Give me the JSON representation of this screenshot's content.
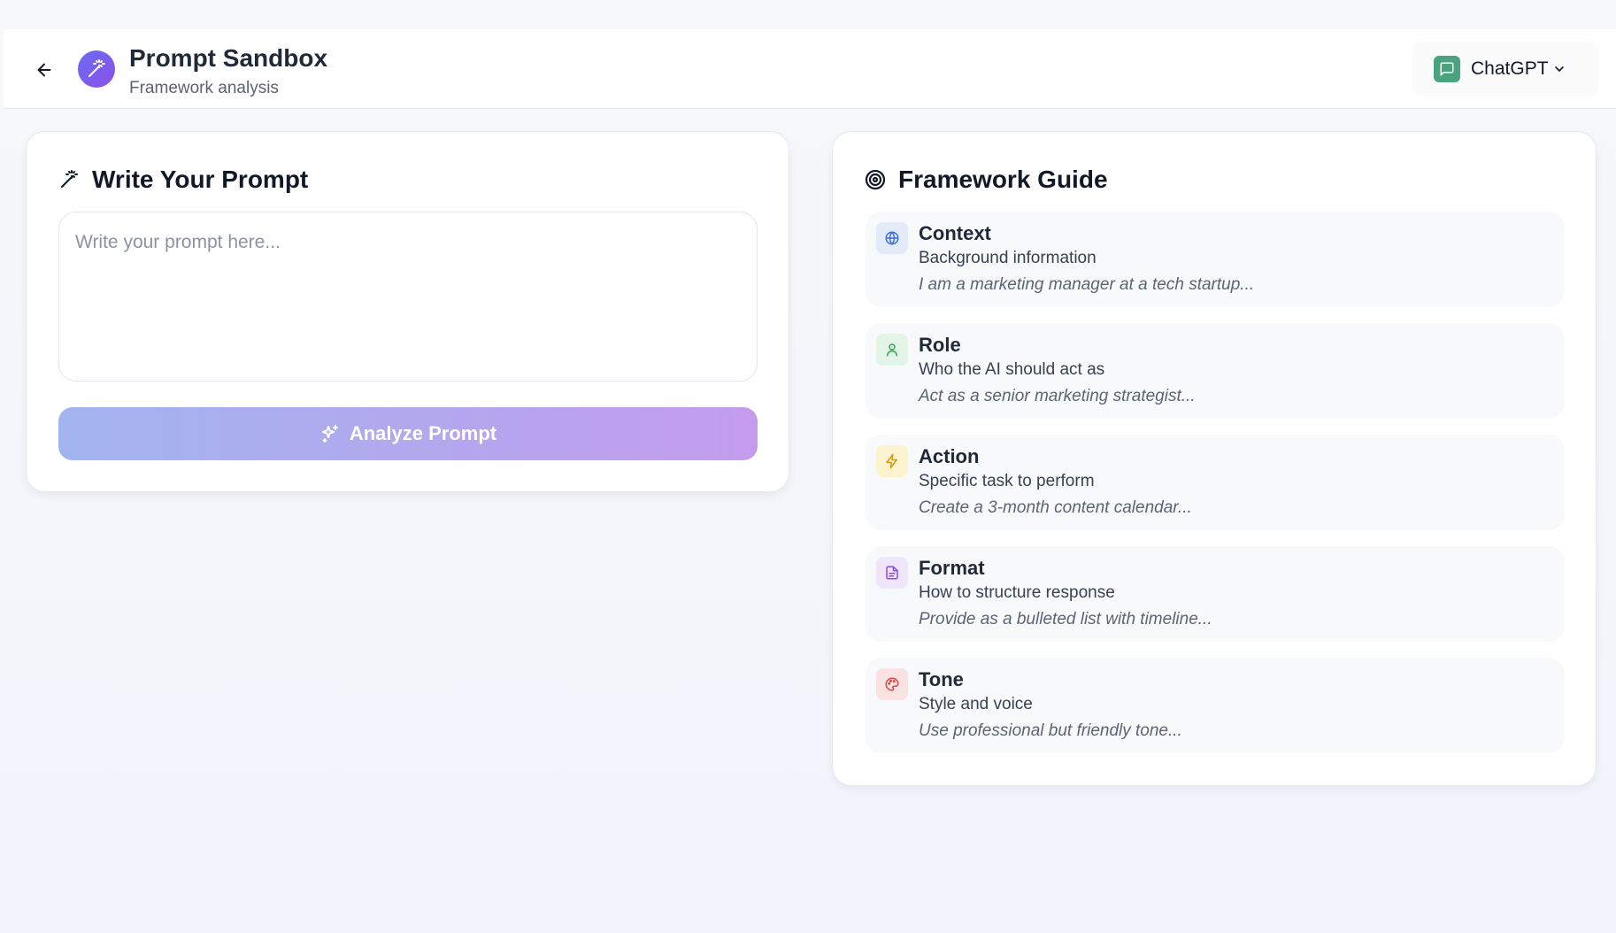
{
  "header": {
    "title": "Prompt Sandbox",
    "subtitle": "Framework analysis",
    "back_icon": "arrow-left-icon",
    "logo_icon": "magic-wand-icon"
  },
  "model_selector": {
    "label": "ChatGPT",
    "icon": "chat-bubble-icon",
    "accent": "#4aa37e"
  },
  "prompt_card": {
    "title": "Write Your Prompt",
    "title_icon": "magic-wand-icon",
    "input": {
      "value": "",
      "placeholder": "Write your prompt here..."
    },
    "analyze_button": {
      "label": "Analyze Prompt",
      "icon": "sparkles-icon"
    }
  },
  "framework_card": {
    "title": "Framework Guide",
    "title_icon": "target-icon",
    "items": [
      {
        "name": "Context",
        "description": "Background information",
        "example": "I am a marketing manager at a tech startup...",
        "icon": "globe-icon",
        "color": "#3b6fd8",
        "bg": "#e3ebfb"
      },
      {
        "name": "Role",
        "description": "Who the AI should act as",
        "example": "Act as a senior marketing strategist...",
        "icon": "user-icon",
        "color": "#3aa35e",
        "bg": "#e2f5e7"
      },
      {
        "name": "Action",
        "description": "Specific task to perform",
        "example": "Create a 3-month content calendar...",
        "icon": "lightning-icon",
        "color": "#d19a12",
        "bg": "#fcf4cf"
      },
      {
        "name": "Format",
        "description": "How to structure response",
        "example": "Provide as a bulleted list with timeline...",
        "icon": "document-icon",
        "color": "#8b4ee8",
        "bg": "#f0e6fb"
      },
      {
        "name": "Tone",
        "description": "Style and voice",
        "example": "Use professional but friendly tone...",
        "icon": "palette-icon",
        "color": "#d94848",
        "bg": "#fbe2e2"
      }
    ]
  }
}
